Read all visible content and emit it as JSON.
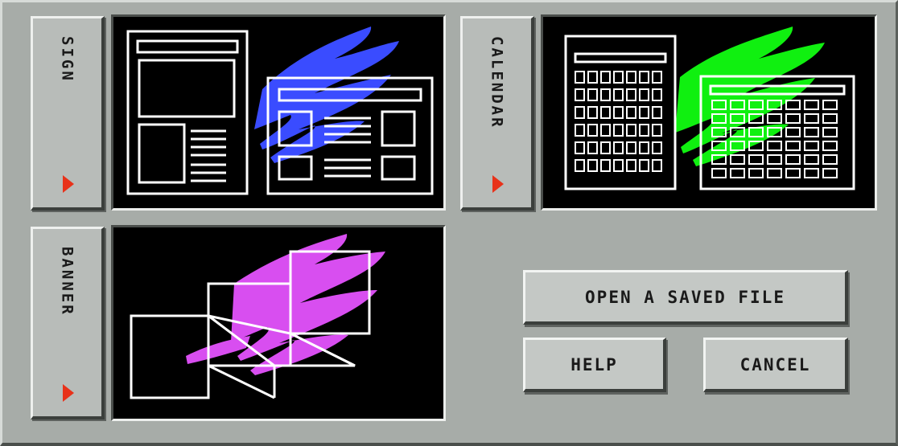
{
  "categories": [
    {
      "id": "sign",
      "label": "SIGN",
      "accent": "#3a4cff"
    },
    {
      "id": "calendar",
      "label": "CALENDAR",
      "accent": "#10f010"
    },
    {
      "id": "banner",
      "label": "BANNER",
      "accent": "#d84ef0"
    }
  ],
  "actions": {
    "open_label": "OPEN A SAVED FILE",
    "help_label": "HELP",
    "cancel_label": "CANCEL"
  },
  "icons": {
    "category_arrow": "right-triangle-icon"
  },
  "colors": {
    "background": "#a7aca8",
    "arrow": "#e8321a",
    "preview_bg": "#000000",
    "outline": "#ffffff"
  }
}
